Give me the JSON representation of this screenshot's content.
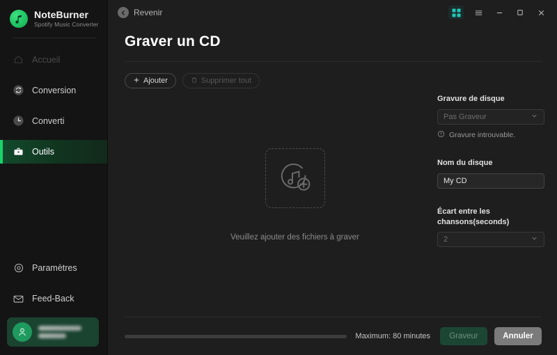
{
  "brand": {
    "title": "NoteBurner",
    "subtitle": "Spotify Music Converter",
    "logo_icon": "music-note-icon",
    "accent": "#19d36a"
  },
  "sidebar": {
    "items": [
      {
        "label": "Accueil",
        "icon": "home-icon",
        "state": "disabled"
      },
      {
        "label": "Conversion",
        "icon": "refresh-icon",
        "state": "normal"
      },
      {
        "label": "Converti",
        "icon": "clock-icon",
        "state": "normal"
      },
      {
        "label": "Outils",
        "icon": "briefcase-icon",
        "state": "active"
      }
    ],
    "bottom_items": [
      {
        "label": "Paramètres",
        "icon": "gear-icon"
      },
      {
        "label": "Feed-Back",
        "icon": "envelope-icon"
      }
    ],
    "account": {
      "avatar_icon": "user-icon",
      "name_masked": true,
      "plan_masked": true
    }
  },
  "titlebar": {
    "back_label": "Revenir",
    "back_icon": "arrow-left-circle-icon",
    "controls": [
      {
        "name": "apps-grid-icon",
        "active": true
      },
      {
        "name": "hamburger-menu-icon",
        "active": false
      },
      {
        "name": "minimize-icon",
        "active": false
      },
      {
        "name": "maximize-icon",
        "active": false
      },
      {
        "name": "close-icon",
        "active": false
      }
    ]
  },
  "main": {
    "page_title": "Graver un CD",
    "toolbar": {
      "add_label": "Ajouter",
      "add_icon": "plus-icon",
      "delete_all_label": "Supprimer tout",
      "delete_all_icon": "trash-icon",
      "delete_all_disabled": true
    },
    "dropzone": {
      "icon": "add-music-disc-icon",
      "hint": "Veuillez ajouter des fichiers à graver"
    },
    "panel": {
      "burner_label": "Gravure de disque",
      "burner_value": "Pas Graveur",
      "burner_chevron": "chevron-down-icon",
      "burner_warning": "Gravure introuvable.",
      "burner_warning_icon": "exclamation-circle-icon",
      "disc_name_label": "Nom du disque",
      "disc_name_value": "My CD",
      "gap_label": "Écart entre les chansons(seconds)",
      "gap_value": "2",
      "gap_chevron": "chevron-down-icon"
    },
    "footer": {
      "progress_percent": 0,
      "max_label": "Maximum: 80 minutes",
      "burn_label": "Graveur",
      "burn_disabled": true,
      "cancel_label": "Annuler"
    }
  }
}
